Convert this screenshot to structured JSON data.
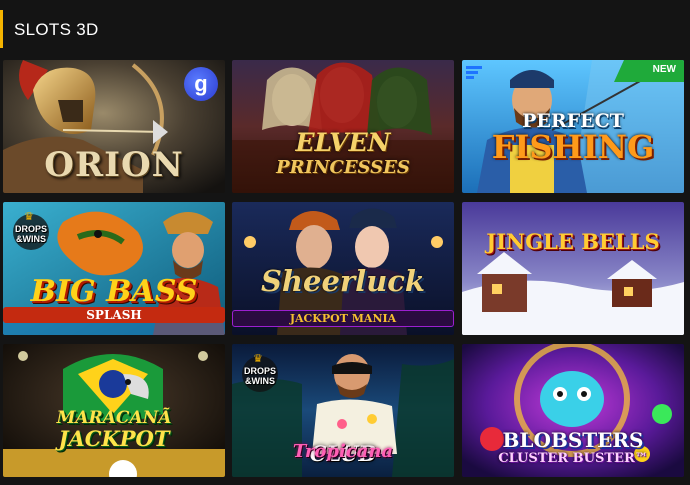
{
  "section": {
    "title": "SLOTS 3D",
    "accent_color": "#f5b400"
  },
  "badges": {
    "new": "NEW",
    "drops": "DROPS",
    "wins": "&WINS",
    "provider_g": "g"
  },
  "games": [
    {
      "title_line1": "ORION",
      "icon": "orion-archer-art"
    },
    {
      "title_line1": "ELVEN",
      "title_line2": "PRINCESSES",
      "icon": "elven-princesses-art"
    },
    {
      "title_line1": "PERFECT",
      "title_line2": "FISHING",
      "icon": "fisherman-art",
      "badge": "NEW"
    },
    {
      "title_line1": "BIG BASS",
      "title_line2": "SPLASH",
      "icon": "big-bass-art",
      "badge": "DROPS &WINS"
    },
    {
      "title_line1": "Sheerluck",
      "title_line2": "JACKPOT MANIA",
      "icon": "detectives-art"
    },
    {
      "title_line1": "JINGLE BELLS",
      "icon": "snowy-village-art"
    },
    {
      "title_line1": "MARACANÃ",
      "title_line2": "JACKPOT",
      "icon": "parrot-football-art"
    },
    {
      "title_line1": "CLUB",
      "title_line2": "Tropicana",
      "icon": "tropical-club-art",
      "badge": "DROPS &WINS"
    },
    {
      "title_line1": "BLOBSTERS",
      "title_line2": "CLUSTER BUSTER™",
      "icon": "blob-monster-art"
    }
  ]
}
